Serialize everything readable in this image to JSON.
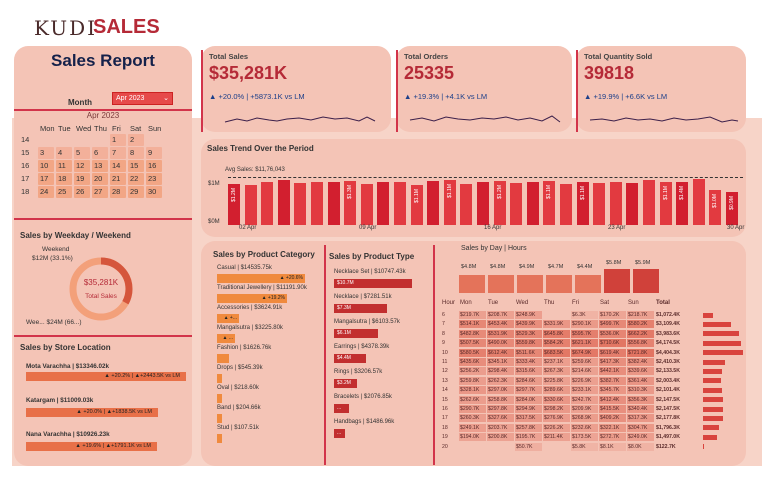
{
  "header": {
    "logo": "KUDI",
    "app": "SALES"
  },
  "left": {
    "title": "Sales Report",
    "month_label": "Month",
    "month_value": "Apr 2023",
    "calendar": {
      "title": "Apr 2023",
      "weekdays": [
        "Mon",
        "Tue",
        "Wed",
        "Thu",
        "Fri",
        "Sat",
        "Sun"
      ],
      "rows": [
        [
          "14",
          "",
          "",
          "",
          "",
          "1",
          "2"
        ],
        [
          "15",
          "3",
          "4",
          "5",
          "6",
          "7",
          "8",
          "9"
        ],
        [
          "16",
          "10",
          "11",
          "12",
          "13",
          "14",
          "15",
          "16"
        ],
        [
          "17",
          "17",
          "18",
          "19",
          "20",
          "21",
          "22",
          "23"
        ],
        [
          "18",
          "24",
          "25",
          "26",
          "27",
          "28",
          "29",
          "30"
        ]
      ]
    },
    "weekday_title": "Sales by Weekday / Weekend",
    "weekend_label": "Weekend",
    "weekend_value": "$12M (33.1%)",
    "weekday_value": "Wee... $24M (66...)",
    "donut_value": "$35,281K",
    "donut_label": "Total Sales",
    "store_title": "Sales by Store Location",
    "stores": [
      {
        "name": "Mota Varachha | $13346.02k",
        "delta": "▲ +20.2% | ▲+2443.5K vs LM"
      },
      {
        "name": "Katargam | $11009.03k",
        "delta": "▲ +20.0% | ▲+1838.5K vs LM"
      },
      {
        "name": "Nana Varachha | $10926.23k",
        "delta": "▲ +19.6% | ▲+1791.1K vs LM"
      }
    ]
  },
  "kpis": [
    {
      "label": "Total Sales",
      "value": "$35,281K",
      "delta": "▲ +20.0% | +5873.1K vs LM"
    },
    {
      "label": "Total Orders",
      "value": "25335",
      "delta": "▲ +19.3% | +4.1K vs LM"
    },
    {
      "label": "Total Quantity Sold",
      "value": "39818",
      "delta": "▲ +19.9% | +6.6K vs LM"
    }
  ],
  "trend": {
    "title": "Sales Trend Over the Period",
    "avg_label": "Avg Sales: $11,76,043",
    "y_ticks": [
      "$1M",
      "$0M"
    ],
    "x_ticks": [
      "02 Apr",
      "09 Apr",
      "16 Apr",
      "23 Apr",
      "30 Apr"
    ],
    "bar_labels": [
      "$1.2M",
      "$1.3M",
      "$1.1M",
      "$1.1M",
      "$1.2M",
      "$1.1M",
      "$1.1M",
      "$1.1M",
      "$1.4M",
      "$1.0M",
      "$0.9M"
    ]
  },
  "category": {
    "title": "Sales by Product Category",
    "items": [
      {
        "name": "Casual | $14535.75k",
        "badge": "▲ +20.6%"
      },
      {
        "name": "Traditional Jewellery | $11191.90k",
        "badge": "▲ +19.2%"
      },
      {
        "name": "Accessories | $3624.91k",
        "badge": "▲ +..."
      },
      {
        "name": "Mangalsutra | $3225.80k",
        "badge": "▲ ..."
      },
      {
        "name": "Fashion | $1626.76k",
        "badge": ""
      },
      {
        "name": "Drops | $545.39k",
        "badge": ""
      },
      {
        "name": "Oval | $218.60k",
        "badge": ""
      },
      {
        "name": "Band | $204.66k",
        "badge": ""
      },
      {
        "name": "Stud | $107.51k",
        "badge": ""
      }
    ]
  },
  "type": {
    "title": "Sales by Product Type",
    "items": [
      {
        "name": "Necklace Set | $10747.43k",
        "bar": "$10.7M"
      },
      {
        "name": "Necklace | $7281.51k",
        "bar": "$7.3M"
      },
      {
        "name": "Mangalsutra | $6103.57k",
        "bar": "$6.1M"
      },
      {
        "name": "Earrings | $4378.39k",
        "bar": "$4.4M"
      },
      {
        "name": "Rings | $3206.57k",
        "bar": "$3.2M"
      },
      {
        "name": "Bracelets | $2076.85k",
        "bar": "..."
      },
      {
        "name": "Handbags | $1486.96k",
        "bar": "..."
      }
    ]
  },
  "hours": {
    "title": "Sales by Day | Hours",
    "day_totals": [
      "$4.8M",
      "$4.8M",
      "$4.9M",
      "$4.7M",
      "$4.4M",
      "$5.8M",
      "$5.9M"
    ],
    "day_levels": [
      0.83,
      0.83,
      0.84,
      0.81,
      0.76,
      1.0,
      1.02
    ],
    "columns": [
      "Hour",
      "Mon",
      "Tue",
      "Wed",
      "Thu",
      "Fri",
      "Sat",
      "Sun",
      "Total"
    ],
    "rows": [
      [
        "6",
        "$219.7K",
        "$208.7K",
        "$248.9K",
        "",
        "$6.3K",
        "$170.2K",
        "$218.7K",
        "$1,072.4K"
      ],
      [
        "7",
        "$514.1K",
        "$453.4K",
        "$439.9K",
        "$331.9K",
        "$290.1K",
        "$499.7K",
        "$580.2K",
        "$3,109.4K"
      ],
      [
        "8",
        "$482.8K",
        "$531.9K",
        "$529.3K",
        "$645.8K",
        "$595.7K",
        "$536.0K",
        "$662.2K",
        "$3,983.6K"
      ],
      [
        "9",
        "$507.5K",
        "$490.0K",
        "$559.8K",
        "$584.2K",
        "$621.1K",
        "$710.6K",
        "$556.8K",
        "$4,174.5K"
      ],
      [
        "10",
        "$580.5K",
        "$612.4K",
        "$511.6K",
        "$683.5K",
        "$674.9K",
        "$619.4K",
        "$721.8K",
        "$4,404.3K"
      ],
      [
        "11",
        "$435.6K",
        "$345.1K",
        "$333.4K",
        "$237.1K",
        "$259.6K",
        "$417.3K",
        "$382.4K",
        "$2,410.3K"
      ],
      [
        "12",
        "$256.2K",
        "$298.4K",
        "$315.6K",
        "$267.3K",
        "$214.6K",
        "$442.1K",
        "$339.6K",
        "$2,133.5K"
      ],
      [
        "13",
        "$259.8K",
        "$262.3K",
        "$284.6K",
        "$225.8K",
        "$226.9K",
        "$382.7K",
        "$361.4K",
        "$2,003.4K"
      ],
      [
        "14",
        "$328.1K",
        "$297.0K",
        "$297.7K",
        "$289.6K",
        "$233.1K",
        "$345.7K",
        "$310.3K",
        "$2,101.4K"
      ],
      [
        "15",
        "$262.6K",
        "$258.8K",
        "$284.0K",
        "$330.6K",
        "$242.7K",
        "$412.4K",
        "$356.3K",
        "$2,147.5K"
      ],
      [
        "16",
        "$290.7K",
        "$297.8K",
        "$294.9K",
        "$298.2K",
        "$209.9K",
        "$415.5K",
        "$340.4K",
        "$2,147.5K"
      ],
      [
        "17",
        "$260.3K",
        "$327.6K",
        "$317.5K",
        "$276.9K",
        "$268.9K",
        "$409.2K",
        "$317.3K",
        "$2,177.8K"
      ],
      [
        "18",
        "$249.1K",
        "$203.7K",
        "$257.8K",
        "$226.2K",
        "$232.6K",
        "$322.1K",
        "$304.7K",
        "$1,796.3K"
      ],
      [
        "19",
        "$194.0K",
        "$200.8K",
        "$195.7K",
        "$211.4K",
        "$173.5K",
        "$272.7K",
        "$249.0K",
        "$1,497.0K"
      ],
      [
        "20",
        "",
        "",
        "$50.7K",
        "",
        "$5.8K",
        "$8.1K",
        "$8.0K",
        "$122.7K"
      ]
    ]
  }
}
